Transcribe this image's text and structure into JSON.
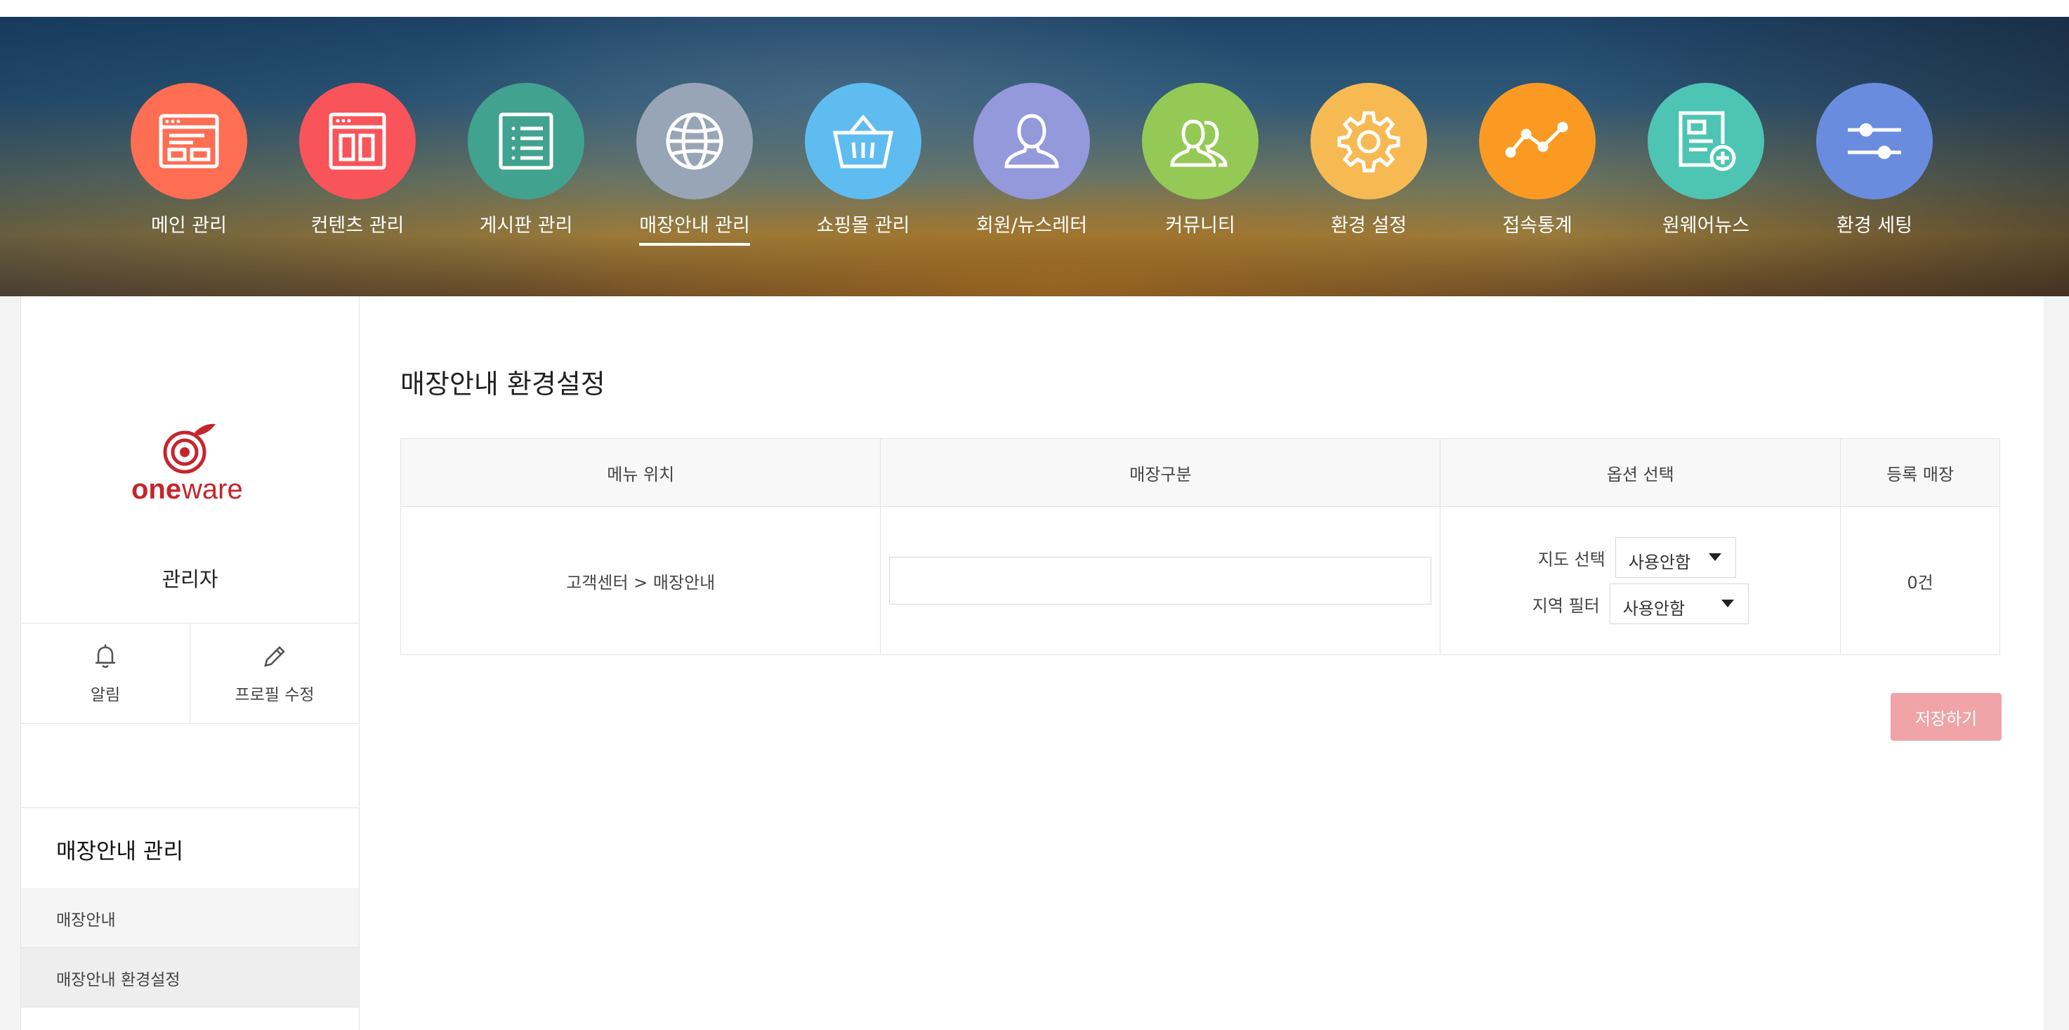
{
  "nav": {
    "items": [
      {
        "label": "메인 관리",
        "icon": "layout-browser-icon",
        "color": "#fe6e53"
      },
      {
        "label": "컨텐츠 관리",
        "icon": "content-window-icon",
        "color": "#f9545a"
      },
      {
        "label": "게시판 관리",
        "icon": "list-board-icon",
        "color": "#41a28f"
      },
      {
        "label": "매장안내 관리",
        "icon": "globe-icon",
        "color": "#98a5b7"
      },
      {
        "label": "쇼핑몰 관리",
        "icon": "shopping-basket-icon",
        "color": "#5fbcf1"
      },
      {
        "label": "회원/뉴스레터",
        "icon": "user-icon",
        "color": "#9499dc"
      },
      {
        "label": "커뮤니티",
        "icon": "users-icon",
        "color": "#94c955"
      },
      {
        "label": "환경 설정",
        "icon": "gear-icon",
        "color": "#f7ba53"
      },
      {
        "label": "접속통계",
        "icon": "line-chart-icon",
        "color": "#fb9a23"
      },
      {
        "label": "원웨어뉴스",
        "icon": "add-document-icon",
        "color": "#4ec4b4"
      },
      {
        "label": "환경 세팅",
        "icon": "sliders-icon",
        "color": "#6a8cdf"
      }
    ],
    "active_index": 3
  },
  "sidebar": {
    "logo_text_bold": "one",
    "logo_text_light": "ware",
    "logo_color": "#c6252c",
    "admin_name": "관리자",
    "quick": {
      "notice_label": "알림",
      "profile_label": "프로필 수정"
    },
    "section_title": "매장안내 관리",
    "items": [
      {
        "label": "매장안내"
      },
      {
        "label": "매장안내 환경설정"
      }
    ]
  },
  "main": {
    "title": "매장안내 환경설정",
    "table": {
      "headers": [
        "메뉴 위치",
        "매장구분",
        "옵션 선택",
        "등록 매장"
      ],
      "row": {
        "menu_location": "고객센터 > 매장안내",
        "store_category_value": "",
        "map_label": "지도 선택",
        "map_value": "사용안함",
        "region_label": "지역 필터",
        "region_value": "사용안함",
        "registered_count": "0건"
      }
    },
    "save_label": "저장하기",
    "save_color": "#f0a4a8"
  }
}
